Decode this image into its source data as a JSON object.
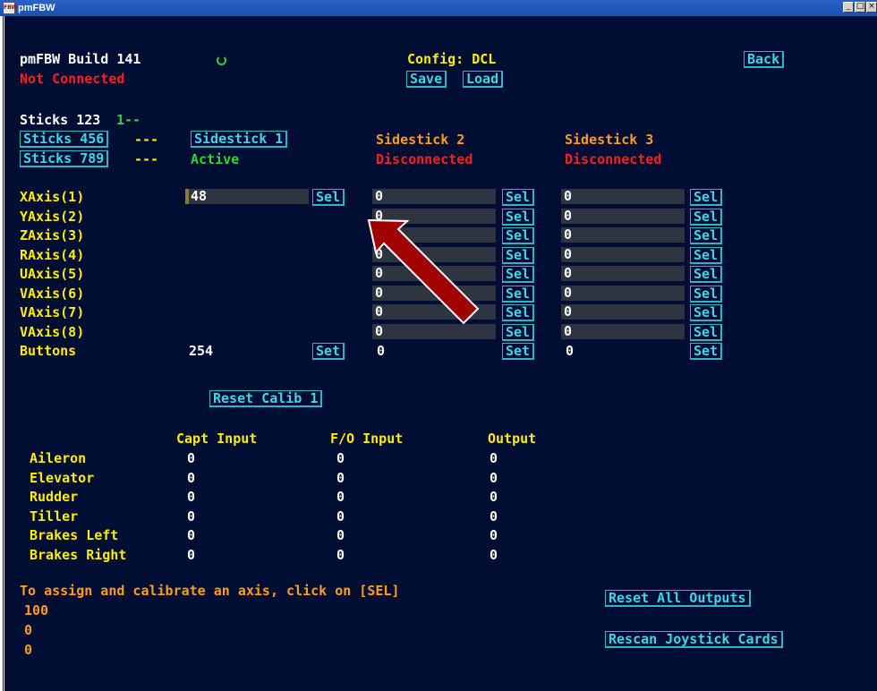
{
  "window": {
    "title": "pmFBW",
    "icon_label": "FBW",
    "controls": [
      "_",
      "□",
      "×"
    ]
  },
  "header": {
    "build": "pmFBW Build 141",
    "status": "Not Connected",
    "config": "Config: DCL",
    "save": "Save",
    "load": "Load",
    "back": "Back"
  },
  "sticks": {
    "group_label": "Sticks 123",
    "group_state": "1--",
    "btn_456": "Sticks 456",
    "state_456": "---",
    "btn_789": "Sticks 789",
    "state_789": "---",
    "sidestick1": "Sidestick 1",
    "sidestick1_status": "Active",
    "sidestick2": "Sidestick 2",
    "sidestick2_status": "Disconnected",
    "sidestick3": "Sidestick 3",
    "sidestick3_status": "Disconnected"
  },
  "axes": {
    "sel_label": "Sel",
    "set_label": "Set",
    "rows": [
      {
        "label": "XAxis(1)",
        "s1": "48",
        "s2": "0",
        "s3": "0"
      },
      {
        "label": "YAxis(2)",
        "s1": "",
        "s2": "0",
        "s3": "0"
      },
      {
        "label": "ZAxis(3)",
        "s1": "",
        "s2": "0",
        "s3": "0"
      },
      {
        "label": "RAxis(4)",
        "s1": "",
        "s2": "0",
        "s3": "0"
      },
      {
        "label": "UAxis(5)",
        "s1": "",
        "s2": "0",
        "s3": "0"
      },
      {
        "label": "VAxis(6)",
        "s1": "",
        "s2": "0",
        "s3": "0"
      },
      {
        "label": "VAxis(7)",
        "s1": "",
        "s2": "0",
        "s3": "0"
      },
      {
        "label": "VAxis(8)",
        "s1": "",
        "s2": "0",
        "s3": "0"
      }
    ],
    "buttons": {
      "label": "Buttons",
      "s1": "254",
      "s2": "0",
      "s3": "0"
    },
    "reset_calib": "Reset Calib 1"
  },
  "outputs": {
    "headers": {
      "capt": "Capt Input",
      "fo": "F/O Input",
      "out": "Output"
    },
    "rows": [
      {
        "label": "Aileron",
        "capt": "0",
        "fo": "0",
        "out": "0"
      },
      {
        "label": "Elevator",
        "capt": "0",
        "fo": "0",
        "out": "0"
      },
      {
        "label": "Rudder",
        "capt": "0",
        "fo": "0",
        "out": "0"
      },
      {
        "label": "Tiller",
        "capt": "0",
        "fo": "0",
        "out": "0"
      },
      {
        "label": "Brakes Left",
        "capt": "0",
        "fo": "0",
        "out": "0"
      },
      {
        "label": "Brakes Right",
        "capt": "0",
        "fo": "0",
        "out": "0"
      }
    ]
  },
  "footer": {
    "instruction": "To assign and calibrate an axis, click on [SEL]",
    "values": [
      "100",
      "0",
      "0"
    ],
    "reset_all": "Reset All Outputs",
    "rescan": "Rescan Joystick Cards"
  },
  "colors": {
    "background": "#000e34",
    "label_yellow": "#ffec00",
    "text_white": "#ffffff",
    "alert_red": "#ff1e1e",
    "ok_green": "#2ed52e",
    "orange": "#ff9d1e",
    "button_cyan": "#3fd5e8",
    "field_gray": "#2e3440",
    "annotation_arrow": "#a00000"
  },
  "icons": {
    "spinner": "loading-spinner-icon",
    "arrow": "annotation-arrow-icon"
  }
}
